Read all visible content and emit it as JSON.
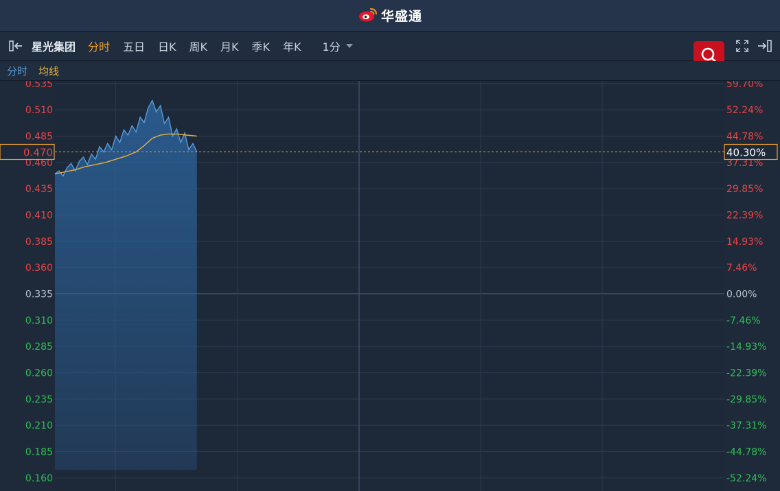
{
  "header": {
    "brand": "华盛通"
  },
  "toolbar": {
    "stock_name": "星光集团",
    "tabs": [
      "分时",
      "五日",
      "日K",
      "周K",
      "月K",
      "季K",
      "年K"
    ],
    "active_tab": "分时",
    "interval": "1分"
  },
  "legend": {
    "price": "分时",
    "average": "均线"
  },
  "colors": {
    "up": "#e84545",
    "down": "#2fbf55",
    "neutral": "#b8c2cf",
    "price_line": "#5b9bd9",
    "avg_line": "#e8b23a",
    "current": "#f0a030",
    "grid": "#2c3b50"
  },
  "chart_data": {
    "type": "line",
    "title": "",
    "prev_close": 0.335,
    "current_price": "0.470",
    "current_change": "40.30%",
    "ylim": [
      0.1475,
      0.5375
    ],
    "y_ticks": [
      0.535,
      0.51,
      0.485,
      0.46,
      0.435,
      0.41,
      0.385,
      0.36,
      0.335,
      0.31,
      0.285,
      0.26,
      0.235,
      0.21,
      0.185,
      0.16
    ],
    "y_tick_labels": [
      "0.535",
      "0.510",
      "0.485",
      "0.460",
      "0.435",
      "0.410",
      "0.385",
      "0.360",
      "0.335",
      "0.310",
      "0.285",
      "0.260",
      "0.235",
      "0.210",
      "0.185",
      "0.160"
    ],
    "pct_tick_labels": [
      "59.70%",
      "52.24%",
      "44.78%",
      "37.31%",
      "29.85%",
      "22.39%",
      "14.93%",
      "7.46%",
      "0.00%",
      "-7.46%",
      "-14.93%",
      "-22.39%",
      "-29.85%",
      "-37.31%",
      "-44.78%",
      "-52.24%"
    ],
    "total_minutes": 330,
    "series": [
      {
        "name": "分时",
        "x": [
          0,
          2,
          4,
          6,
          8,
          10,
          12,
          14,
          16,
          18,
          20,
          22,
          24,
          26,
          28,
          30,
          32,
          34,
          36,
          38,
          40,
          42,
          44,
          46,
          48,
          50,
          52,
          54,
          56,
          58,
          60,
          62,
          64,
          66,
          68,
          70
        ],
        "values": [
          0.449,
          0.452,
          0.447,
          0.455,
          0.459,
          0.452,
          0.461,
          0.465,
          0.458,
          0.468,
          0.463,
          0.475,
          0.47,
          0.478,
          0.472,
          0.485,
          0.479,
          0.491,
          0.486,
          0.495,
          0.489,
          0.503,
          0.498,
          0.512,
          0.519,
          0.508,
          0.514,
          0.497,
          0.503,
          0.485,
          0.492,
          0.479,
          0.488,
          0.472,
          0.478,
          0.47
        ]
      },
      {
        "name": "均线",
        "x": [
          0,
          5,
          10,
          15,
          20,
          25,
          30,
          35,
          40,
          44,
          48,
          52,
          56,
          60,
          65,
          70
        ],
        "values": [
          0.449,
          0.451,
          0.453,
          0.456,
          0.458,
          0.46,
          0.463,
          0.466,
          0.47,
          0.476,
          0.483,
          0.486,
          0.487,
          0.487,
          0.486,
          0.485
        ]
      }
    ],
    "bottom_labels": [
      "",
      ""
    ]
  }
}
